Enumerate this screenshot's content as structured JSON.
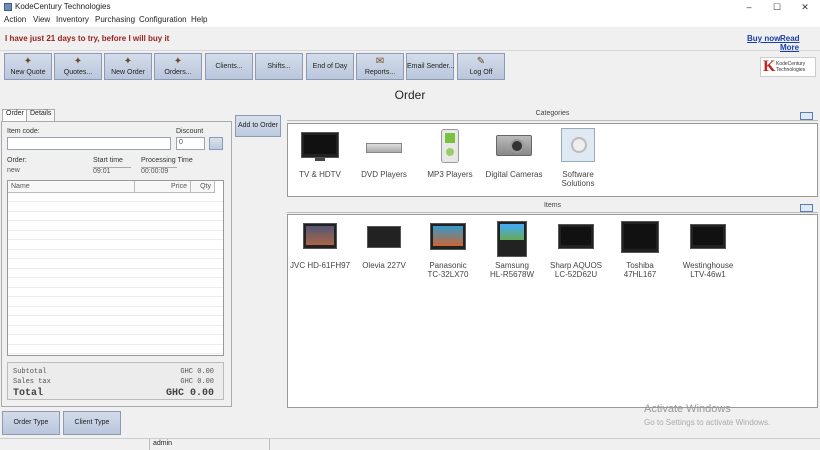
{
  "window": {
    "title": "KodeCentury Technologies",
    "controls": [
      "–",
      "☐",
      "✕"
    ]
  },
  "menu": [
    "Action",
    "View",
    "Inventory",
    "Purchasing",
    "Configuration",
    "Help"
  ],
  "trial": {
    "message": "I have just 21 days to try, before I will buy it",
    "buy_now": "Buy now",
    "read_more": "Read More"
  },
  "toolbar": [
    {
      "label": "New Quote",
      "icon": "new-quote-icon"
    },
    {
      "label": "Quotes...",
      "icon": "quotes-icon"
    },
    {
      "label": "New Order",
      "icon": "new-order-icon"
    },
    {
      "label": "Orders...",
      "icon": "orders-icon"
    },
    {
      "label": "Clients...",
      "icon": ""
    },
    {
      "label": "Shifts...",
      "icon": ""
    },
    {
      "label": "End of Day",
      "icon": ""
    },
    {
      "label": "Reports...",
      "icon": "reports-icon"
    },
    {
      "label": "Email Sender...",
      "icon": ""
    },
    {
      "label": "Log Off",
      "icon": "log-off-icon"
    }
  ],
  "brand": {
    "logo_letter": "K",
    "logo_text": "KodeCentury Technologies"
  },
  "heading": "Order",
  "tabs": [
    "Order",
    "Details"
  ],
  "order_form": {
    "item_code_label": "Item code:",
    "item_code_value": "",
    "discount_label": "Discount",
    "discount_value": "0",
    "order_label": "Order:",
    "order_value": "new",
    "start_time_label": "Start time",
    "start_time_value": "09:01",
    "processing_time_label": "Processing Time",
    "processing_time_value": "00:00:09",
    "columns": [
      "Name",
      "Price",
      "Qty"
    ],
    "totals": [
      {
        "label": "Subtotal",
        "value": "GHC 0.00"
      },
      {
        "label": "Sales tax",
        "value": "GHC 0.00"
      },
      {
        "label": "Total",
        "value": "GHC 0.00"
      }
    ]
  },
  "add_to_order": "Add to Order",
  "categories": {
    "header": "Categories",
    "items": [
      "TV & HDTV",
      "DVD Players",
      "MP3 Players",
      "Digital Cameras",
      "Software Solutions"
    ]
  },
  "items": {
    "header": "Items",
    "products": [
      {
        "line1": "JVC HD-61FH97",
        "line2": ""
      },
      {
        "line1": "Olevia 227V",
        "line2": ""
      },
      {
        "line1": "Panasonic",
        "line2": "TC-32LX70"
      },
      {
        "line1": "Samsung",
        "line2": "HL-R5678W"
      },
      {
        "line1": "Sharp AQUOS",
        "line2": "LC-52D62U"
      },
      {
        "line1": "Toshiba",
        "line2": "47HL167"
      },
      {
        "line1": "Westinghouse",
        "line2": "LTV-46w1"
      }
    ]
  },
  "bottom_buttons": [
    "Order Type",
    "Client Type"
  ],
  "status": {
    "user": "admin"
  },
  "watermark": {
    "line1": "Activate Windows",
    "line2": "Go to Settings to activate Windows."
  }
}
